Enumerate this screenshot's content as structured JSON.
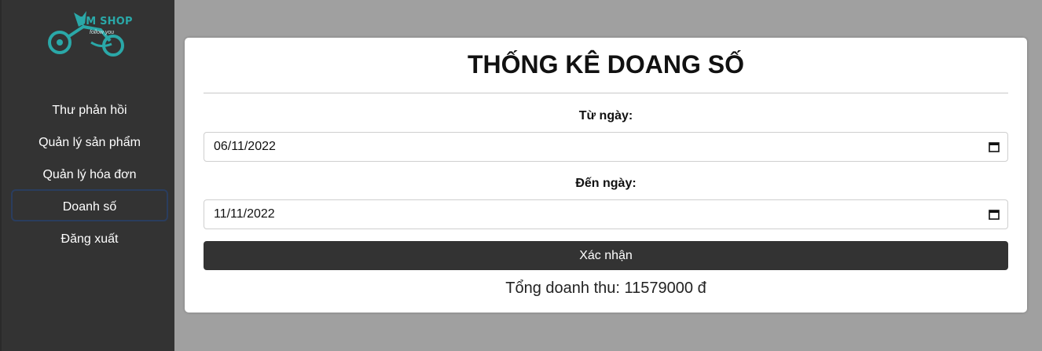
{
  "brand": {
    "name": "QM SHOP",
    "tagline": "follow you",
    "color": "#2aa8a8"
  },
  "sidebar": {
    "items": [
      {
        "label": "Thư phản hồi",
        "active": false
      },
      {
        "label": "Quản lý sản phẩm",
        "active": false
      },
      {
        "label": "Quản lý hóa đơn",
        "active": false
      },
      {
        "label": "Doanh số",
        "active": true
      },
      {
        "label": "Đăng xuất",
        "active": false
      }
    ]
  },
  "main": {
    "title": "THỐNG KÊ DOANG SỐ",
    "from_label": "Từ ngày:",
    "from_value": "06/11/2022",
    "to_label": "Đến ngày:",
    "to_value": "11/11/2022",
    "submit_label": "Xác nhận",
    "total_text": "Tổng doanh thu: 11579000 đ"
  },
  "icons": {
    "date_picker": "calendar-icon",
    "logo": "motorbike-icon"
  }
}
